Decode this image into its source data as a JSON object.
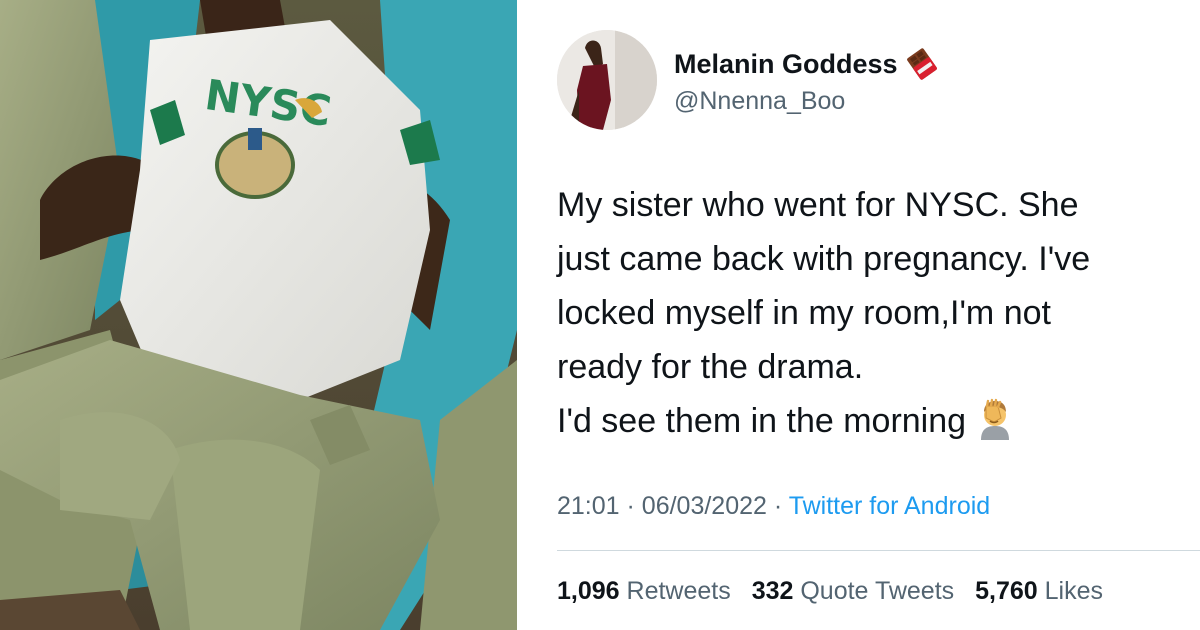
{
  "user": {
    "display_name": "Melanin Goddess",
    "handle": "@Nnenna_Boo",
    "name_emoji_icon": "chocolate-bar-icon"
  },
  "tweet": {
    "lines": [
      "My sister who went for NYSC. She",
      "just came back with pregnancy. I've",
      "locked myself in my room,I'm not",
      "ready for the drama.",
      "I'd see them in the morning"
    ],
    "end_emoji_icon": "facepalm-icon",
    "time": "21:01",
    "separator": "·",
    "date": "06/03/2022",
    "source": "Twitter for Android"
  },
  "stats": {
    "retweets_count": "1,096",
    "retweets_label": "Retweets",
    "quotes_count": "332",
    "quotes_label": "Quote Tweets",
    "likes_count": "5,760",
    "likes_label": "Likes"
  },
  "colors": {
    "text_primary": "#0f1419",
    "text_secondary": "#536471",
    "link": "#1d9bf0",
    "divider": "#cfd9de"
  }
}
